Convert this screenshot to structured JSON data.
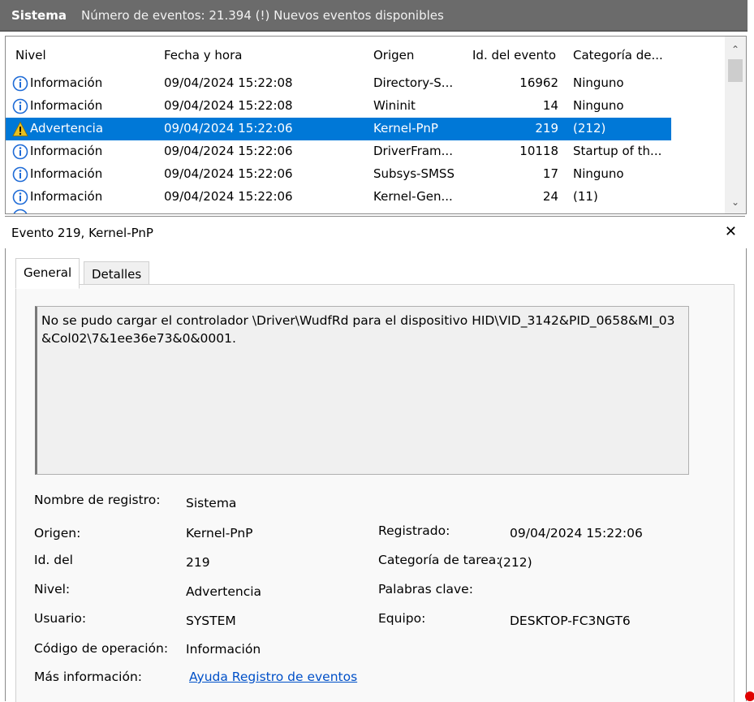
{
  "header": {
    "title": "Sistema",
    "subtitle": "Número de eventos: 21.394 (!) Nuevos eventos disponibles"
  },
  "list": {
    "columns": [
      "Nivel",
      "Fecha y hora",
      "Origen",
      "Id. del evento",
      "Categoría de..."
    ],
    "rows": [
      {
        "level": "Información",
        "icon": "info-icon",
        "datetime": "09/04/2024 15:22:08",
        "source": "Directory-S...",
        "id": "16962",
        "category": "Ninguno"
      },
      {
        "level": "Información",
        "icon": "info-icon",
        "datetime": "09/04/2024 15:22:08",
        "source": "Wininit",
        "id": "14",
        "category": "Ninguno"
      },
      {
        "level": "Advertencia",
        "icon": "warning-icon",
        "datetime": "09/04/2024 15:22:06",
        "source": "Kernel-PnP",
        "id": "219",
        "category": "(212)"
      },
      {
        "level": "Información",
        "icon": "info-icon",
        "datetime": "09/04/2024 15:22:06",
        "source": "DriverFram...",
        "id": "10118",
        "category": "Startup of th..."
      },
      {
        "level": "Información",
        "icon": "info-icon",
        "datetime": "09/04/2024 15:22:06",
        "source": "Subsys-SMSS",
        "id": "17",
        "category": "Ninguno"
      },
      {
        "level": "Información",
        "icon": "info-icon",
        "datetime": "09/04/2024 15:22:06",
        "source": "Kernel-Gen...",
        "id": "24",
        "category": "(11)"
      }
    ]
  },
  "detail": {
    "title": "Evento 219, Kernel-PnP",
    "tabs": [
      "General",
      "Detalles"
    ],
    "description_line1": "No se pudo cargar el controlador \\Driver\\WudfRd para el dispositivo HID\\VID_3142&PID_0658&MI_03",
    "description_line2": "&Col02\\7&1ee36e73&0&0001.",
    "labels": {
      "log_name": "Nombre de registro:",
      "source": "Origen:",
      "event_id": "Id. del",
      "level": "Nivel:",
      "user": "Usuario:",
      "opcode": "Código de operación:",
      "more_info": "Más información:",
      "logged": "Registrado:",
      "task_category": "Categoría de tarea:",
      "keywords": "Palabras clave:",
      "computer": "Equipo:"
    },
    "values": {
      "log_name": "Sistema",
      "source": "Kernel-PnP",
      "event_id": "219",
      "level": "Advertencia",
      "user": "SYSTEM",
      "opcode": "Información",
      "more_info": "Ayuda Registro de eventos",
      "logged": "09/04/2024 15:22:06",
      "task_category": "(212)",
      "keywords": "",
      "computer": "DESKTOP-FC3NGT6"
    }
  },
  "colors": {
    "header_bg": "#6b6b6b",
    "selection": "#0078d7",
    "info_icon": "#1e6bd6",
    "warning_icon": "#e8c020",
    "link": "#0050c8"
  }
}
